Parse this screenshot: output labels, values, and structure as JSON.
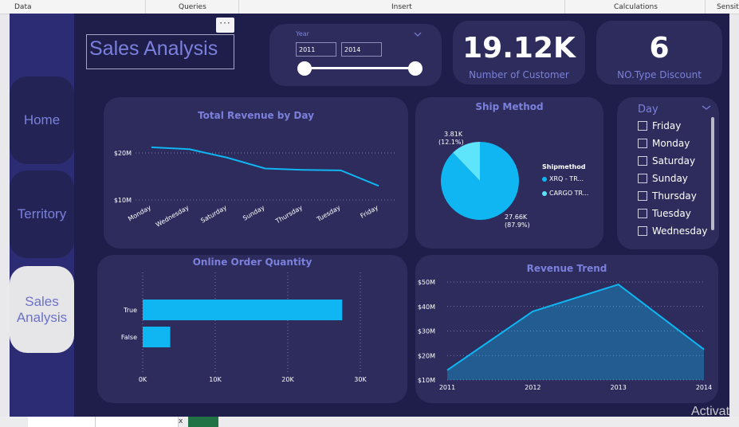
{
  "ribbon": {
    "data": "Data",
    "queries": "Queries",
    "insert": "Insert",
    "calculations": "Calculations",
    "sensitivity": "Sensiti"
  },
  "nav": {
    "home": "Home",
    "territory": "Territory",
    "sales_line1": "Sales",
    "sales_line2": "Analysis"
  },
  "report_title": "Sales Analysis",
  "more_icon": "···",
  "year_filter": {
    "label": "Year",
    "from": "2011",
    "to": "2014"
  },
  "kpi_customers": {
    "value": "19.12K",
    "label": "Number of Customer"
  },
  "kpi_discount": {
    "value": "6",
    "label": "NO.Type Discount"
  },
  "day_slicer": {
    "title": "Day",
    "items": [
      "Friday",
      "Monday",
      "Saturday",
      "Sunday",
      "Thursday",
      "Tuesday",
      "Wednesday"
    ]
  },
  "ship_legend": {
    "title": "Shipmethod",
    "item1": "XRQ - TR...",
    "item2": "CARGO TR..."
  },
  "colors": {
    "accent": "#7b80dc",
    "series": "#0fb6f2",
    "series2": "#5ee4fb",
    "card": "#2d2c5c",
    "background": "#1f1e4a"
  },
  "watermark": "Activat",
  "chart_data": [
    {
      "type": "line",
      "title": "Total Revenue by Day",
      "categories": [
        "Monday",
        "Wednesday",
        "Saturday",
        "Sunday",
        "Thursday",
        "Tuesday",
        "Friday"
      ],
      "values": [
        21.2,
        20.8,
        19.0,
        16.7,
        16.4,
        16.3,
        13.0
      ],
      "ylim": [
        10,
        20
      ],
      "yticks": [
        "$10M",
        "$20M"
      ],
      "grid": true
    },
    {
      "type": "pie",
      "title": "Ship Method",
      "labels": [
        "XRQ - TR...",
        "CARGO TR..."
      ],
      "values": [
        27.66,
        3.81
      ],
      "value_labels": [
        "27.66K",
        "3.81K"
      ],
      "percent_labels": [
        "(87.9%)",
        "(12.1%)"
      ],
      "legend_title": "Shipmethod",
      "legend": "right"
    },
    {
      "type": "bar",
      "orientation": "horizontal",
      "title": "Online Order Quantity",
      "categories": [
        "True",
        "False"
      ],
      "values": [
        27.5,
        3.8
      ],
      "xlim": [
        0,
        30
      ],
      "xticks": [
        "0K",
        "10K",
        "20K",
        "30K"
      ],
      "grid": true
    },
    {
      "type": "area",
      "title": "Revenue Trend",
      "x": [
        "2011",
        "2012",
        "2013",
        "2014"
      ],
      "values": [
        14,
        38,
        49,
        22.5
      ],
      "ylim": [
        10,
        50
      ],
      "yticks": [
        "$10M",
        "$20M",
        "$30M",
        "$40M",
        "$50M"
      ],
      "grid": true
    }
  ]
}
